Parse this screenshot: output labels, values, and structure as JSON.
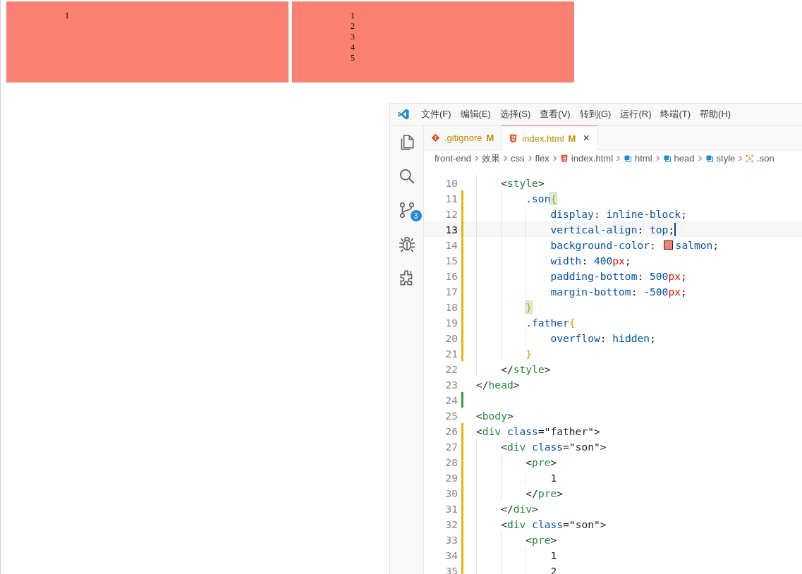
{
  "browser_page": {
    "boxes": [
      {
        "lines": [
          "1"
        ]
      },
      {
        "lines": [
          "1",
          "2",
          "3",
          "4",
          "5"
        ]
      }
    ]
  },
  "editor_window": {
    "menu": [
      "文件(F)",
      "编辑(E)",
      "选择(S)",
      "查看(V)",
      "转到(G)",
      "运行(R)",
      "终端(T)",
      "帮助(H)"
    ],
    "activity_bar": [
      {
        "kind": "files"
      },
      {
        "kind": "search"
      },
      {
        "kind": "source-control",
        "badge": "3"
      },
      {
        "kind": "debug"
      },
      {
        "kind": "extensions"
      }
    ],
    "tabs": [
      {
        "kind": "git",
        "label": ".gitignore",
        "status": "M",
        "selected": false
      },
      {
        "kind": "html",
        "label": "index.html",
        "status": "M",
        "selected": true,
        "close": "×"
      }
    ],
    "breadcrumbs": [
      {
        "kind": "folder",
        "label": "front-end"
      },
      {
        "kind": "folder",
        "label": "效果"
      },
      {
        "kind": "folder",
        "label": "css"
      },
      {
        "kind": "folder",
        "label": "flex"
      },
      {
        "kind": "html",
        "label": "index.html"
      },
      {
        "kind": "element",
        "label": "html"
      },
      {
        "kind": "element",
        "label": "head"
      },
      {
        "kind": "element",
        "label": "style"
      },
      {
        "kind": "selector",
        "label": ".son"
      }
    ],
    "code_lines": [
      {
        "number": "10",
        "modified": false,
        "added": false,
        "current": false,
        "tokens": [
          {
            "kind": "punct",
            "text": "    <"
          },
          {
            "kind": "tag",
            "text": "style"
          },
          {
            "kind": "punct",
            "text": ">"
          }
        ]
      },
      {
        "number": "11",
        "modified": true,
        "added": false,
        "current": false,
        "tokens": [
          {
            "kind": "selector",
            "text": "        .son"
          },
          {
            "kind": "brace",
            "text": "{",
            "match": true
          }
        ]
      },
      {
        "number": "12",
        "modified": true,
        "added": false,
        "current": false,
        "tokens": [
          {
            "kind": "prop",
            "text": "            display"
          },
          {
            "kind": "punct",
            "text": ": "
          },
          {
            "kind": "value",
            "text": "inline-block"
          },
          {
            "kind": "punct",
            "text": ";"
          }
        ]
      },
      {
        "number": "13",
        "modified": true,
        "added": false,
        "current": true,
        "tokens": [
          {
            "kind": "prop",
            "text": "            vertical-align"
          },
          {
            "kind": "punct",
            "text": ": "
          },
          {
            "kind": "value",
            "text": "top"
          },
          {
            "kind": "punct",
            "text": ";"
          }
        ]
      },
      {
        "number": "14",
        "modified": true,
        "added": false,
        "current": false,
        "tokens": [
          {
            "kind": "prop",
            "text": "            background-color"
          },
          {
            "kind": "punct",
            "text": ": "
          },
          {
            "kind": "swatch",
            "color": "#fa8072"
          },
          {
            "kind": "value",
            "text": "salmon"
          },
          {
            "kind": "punct",
            "text": ";"
          }
        ]
      },
      {
        "number": "15",
        "modified": true,
        "added": false,
        "current": false,
        "tokens": [
          {
            "kind": "prop",
            "text": "            width"
          },
          {
            "kind": "punct",
            "text": ": "
          },
          {
            "kind": "number",
            "text": "400"
          },
          {
            "kind": "unit",
            "text": "px"
          },
          {
            "kind": "punct",
            "text": ";"
          }
        ]
      },
      {
        "number": "16",
        "modified": true,
        "added": false,
        "current": false,
        "tokens": [
          {
            "kind": "prop",
            "text": "            padding-bottom"
          },
          {
            "kind": "punct",
            "text": ": "
          },
          {
            "kind": "number",
            "text": "500"
          },
          {
            "kind": "unit",
            "text": "px"
          },
          {
            "kind": "punct",
            "text": ";"
          }
        ]
      },
      {
        "number": "17",
        "modified": true,
        "added": false,
        "current": false,
        "tokens": [
          {
            "kind": "prop",
            "text": "            margin-bottom"
          },
          {
            "kind": "punct",
            "text": ": "
          },
          {
            "kind": "number",
            "text": "-500"
          },
          {
            "kind": "unit",
            "text": "px"
          },
          {
            "kind": "punct",
            "text": ";"
          }
        ]
      },
      {
        "number": "18",
        "modified": true,
        "added": false,
        "current": false,
        "tokens": [
          {
            "kind": "brace",
            "text": "        }",
            "match": true
          }
        ]
      },
      {
        "number": "19",
        "modified": true,
        "added": false,
        "current": false,
        "tokens": [
          {
            "kind": "selector",
            "text": "        .father"
          },
          {
            "kind": "brace",
            "text": "{",
            "match": false
          }
        ]
      },
      {
        "number": "20",
        "modified": true,
        "added": false,
        "current": false,
        "tokens": [
          {
            "kind": "prop",
            "text": "            overflow"
          },
          {
            "kind": "punct",
            "text": ": "
          },
          {
            "kind": "value",
            "text": "hidden"
          },
          {
            "kind": "punct",
            "text": ";"
          }
        ]
      },
      {
        "number": "21",
        "modified": true,
        "added": false,
        "current": false,
        "tokens": [
          {
            "kind": "brace",
            "text": "        }",
            "match": false
          }
        ]
      },
      {
        "number": "22",
        "modified": false,
        "added": false,
        "current": false,
        "tokens": [
          {
            "kind": "punct",
            "text": "    </"
          },
          {
            "kind": "tag",
            "text": "style"
          },
          {
            "kind": "punct",
            "text": ">"
          }
        ]
      },
      {
        "number": "23",
        "modified": false,
        "added": false,
        "current": false,
        "tokens": [
          {
            "kind": "punct",
            "text": "</"
          },
          {
            "kind": "tag",
            "text": "head"
          },
          {
            "kind": "punct",
            "text": ">"
          }
        ]
      },
      {
        "number": "24",
        "modified": false,
        "added": true,
        "current": false
      },
      {
        "number": "25",
        "modified": false,
        "added": false,
        "current": false,
        "tokens": [
          {
            "kind": "punct",
            "text": "<"
          },
          {
            "kind": "tag",
            "text": "body"
          },
          {
            "kind": "punct",
            "text": ">"
          }
        ]
      },
      {
        "number": "26",
        "modified": true,
        "added": false,
        "current": false,
        "tokens": [
          {
            "kind": "punct",
            "text": "<"
          },
          {
            "kind": "tag",
            "text": "div"
          },
          {
            "kind": "attr",
            "text": " class"
          },
          {
            "kind": "punct",
            "text": "="
          },
          {
            "kind": "string",
            "text": "\"father\""
          },
          {
            "kind": "punct",
            "text": ">"
          }
        ]
      },
      {
        "number": "27",
        "modified": true,
        "added": false,
        "current": false,
        "tokens": [
          {
            "kind": "punct",
            "text": "    <"
          },
          {
            "kind": "tag",
            "text": "div"
          },
          {
            "kind": "attr",
            "text": " class"
          },
          {
            "kind": "punct",
            "text": "="
          },
          {
            "kind": "string",
            "text": "\"son\""
          },
          {
            "kind": "punct",
            "text": ">"
          }
        ]
      },
      {
        "number": "28",
        "modified": true,
        "added": false,
        "current": false,
        "tokens": [
          {
            "kind": "punct",
            "text": "        <"
          },
          {
            "kind": "tag",
            "text": "pre"
          },
          {
            "kind": "punct",
            "text": ">"
          }
        ]
      },
      {
        "number": "29",
        "modified": true,
        "added": false,
        "current": false,
        "tokens": [
          {
            "kind": "text",
            "text": "            1"
          }
        ]
      },
      {
        "number": "30",
        "modified": true,
        "added": false,
        "current": false,
        "tokens": [
          {
            "kind": "punct",
            "text": "        </"
          },
          {
            "kind": "tag",
            "text": "pre"
          },
          {
            "kind": "punct",
            "text": ">"
          }
        ]
      },
      {
        "number": "31",
        "modified": true,
        "added": false,
        "current": false,
        "tokens": [
          {
            "kind": "punct",
            "text": "    </"
          },
          {
            "kind": "tag",
            "text": "div"
          },
          {
            "kind": "punct",
            "text": ">"
          }
        ]
      },
      {
        "number": "32",
        "modified": true,
        "added": false,
        "current": false,
        "tokens": [
          {
            "kind": "punct",
            "text": "    <"
          },
          {
            "kind": "tag",
            "text": "div"
          },
          {
            "kind": "attr",
            "text": " class"
          },
          {
            "kind": "punct",
            "text": "="
          },
          {
            "kind": "string",
            "text": "\"son\""
          },
          {
            "kind": "punct",
            "text": ">"
          }
        ]
      },
      {
        "number": "33",
        "modified": true,
        "added": false,
        "current": false,
        "tokens": [
          {
            "kind": "punct",
            "text": "        <"
          },
          {
            "kind": "tag",
            "text": "pre"
          },
          {
            "kind": "punct",
            "text": ">"
          }
        ]
      },
      {
        "number": "34",
        "modified": true,
        "added": false,
        "current": false,
        "tokens": [
          {
            "kind": "text",
            "text": "            1"
          }
        ]
      },
      {
        "number": "35",
        "modified": true,
        "added": false,
        "current": false,
        "tokens": [
          {
            "kind": "text",
            "text": "            2"
          }
        ]
      }
    ]
  }
}
